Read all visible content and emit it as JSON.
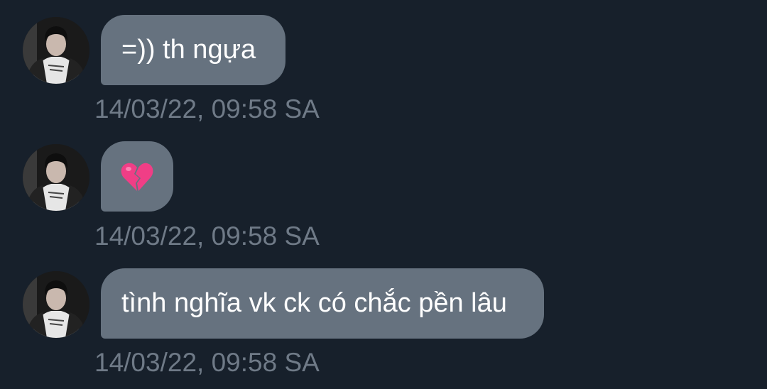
{
  "messages": [
    {
      "text": "=)) th ngựa",
      "timestamp": "14/03/22, 09:58 SA"
    },
    {
      "text": "💔",
      "timestamp": "14/03/22, 09:58 SA"
    },
    {
      "text": "tình nghĩa vk ck có chắc pền lâu",
      "timestamp": "14/03/22, 09:58 SA"
    }
  ],
  "colors": {
    "background": "#17202b",
    "bubble": "#66727f",
    "timestamp": "#6f7a87"
  },
  "icons": {
    "avatar": "avatar",
    "message_2_emoji": "broken-heart-icon"
  }
}
